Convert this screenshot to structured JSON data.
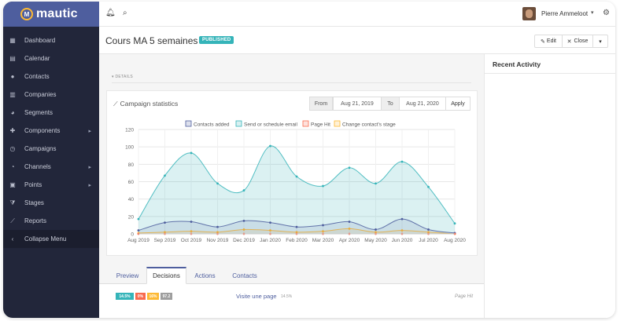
{
  "brand": {
    "name": "mautic",
    "logo_letter": "M"
  },
  "sidebar": {
    "items": [
      {
        "label": "Dashboard",
        "icon": "th-icon",
        "glyph": "▦"
      },
      {
        "label": "Calendar",
        "icon": "calendar-icon",
        "glyph": "▤"
      },
      {
        "label": "Contacts",
        "icon": "user-icon",
        "glyph": "●"
      },
      {
        "label": "Companies",
        "icon": "building-icon",
        "glyph": "▥"
      },
      {
        "label": "Segments",
        "icon": "pie-chart-icon",
        "glyph": "◕"
      },
      {
        "label": "Components",
        "icon": "puzzle-icon",
        "glyph": "✚",
        "has_children": true
      },
      {
        "label": "Campaigns",
        "icon": "clock-icon",
        "glyph": "◷"
      },
      {
        "label": "Channels",
        "icon": "rss-icon",
        "glyph": "◔",
        "has_children": true
      },
      {
        "label": "Points",
        "icon": "calculator-icon",
        "glyph": "▣",
        "has_children": true
      },
      {
        "label": "Stages",
        "icon": "filter-icon",
        "glyph": "⧩"
      },
      {
        "label": "Reports",
        "icon": "line-chart-icon",
        "glyph": "⟋"
      },
      {
        "label": "Collapse Menu",
        "icon": "chevron-left-icon",
        "glyph": "‹"
      }
    ]
  },
  "topbar": {
    "user_name": "Pierre Ammeloot"
  },
  "page": {
    "title": "Cours MA 5 semaines",
    "status": "PUBLISHED",
    "edit_label": "Edit",
    "close_label": "Close",
    "details_label": "▾ DETAILS"
  },
  "stats": {
    "title": "Campaign statistics",
    "from_label": "From",
    "from_value": "Aug 21, 2019",
    "to_label": "To",
    "to_value": "Aug 21, 2020",
    "apply_label": "Apply"
  },
  "chart_data": {
    "type": "area",
    "categories": [
      "Aug 2019",
      "Sep 2019",
      "Oct 2019",
      "Nov 2019",
      "Dec 2019",
      "Jan 2020",
      "Feb 2020",
      "Mar 2020",
      "Apr 2020",
      "May 2020",
      "Jun 2020",
      "Jul 2020",
      "Aug 2020"
    ],
    "ylim": [
      0,
      120
    ],
    "yticks": [
      0,
      20,
      40,
      60,
      80,
      100,
      120
    ],
    "grid": true,
    "legend_position": "top",
    "series": [
      {
        "name": "Contacts added",
        "color": "#4e5e9e",
        "values": [
          4,
          13,
          14,
          8,
          15,
          13,
          8,
          10,
          14,
          5,
          17,
          5,
          1
        ]
      },
      {
        "name": "Send or schedule email",
        "color": "#35b4b9",
        "values": [
          17,
          67,
          93,
          58,
          50,
          101,
          66,
          55,
          76,
          58,
          83,
          54,
          12
        ]
      },
      {
        "name": "Page Hit",
        "color": "#f86b4f",
        "values": [
          0,
          0,
          0,
          0,
          0,
          0,
          0,
          0,
          0,
          0,
          0,
          0,
          0
        ]
      },
      {
        "name": "Change contact's stage",
        "color": "#fdb933",
        "values": [
          1,
          2,
          3,
          2,
          5,
          4,
          2,
          3,
          6,
          2,
          4,
          2,
          0
        ]
      }
    ]
  },
  "tabs": [
    {
      "label": "Preview",
      "active": false
    },
    {
      "label": "Decisions",
      "active": true
    },
    {
      "label": "Actions",
      "active": false
    },
    {
      "label": "Contacts",
      "active": false
    }
  ],
  "decision": {
    "badges": [
      {
        "text": "14.5%",
        "color": "#35b4b9"
      },
      {
        "text": "0%",
        "color": "#f86b4f"
      },
      {
        "text": "16%",
        "color": "#fdb933"
      },
      {
        "text": "97.2",
        "color": "#9e9e9e"
      }
    ],
    "name": "Visite une page",
    "pct": "14.5%",
    "type": "Page Hit"
  },
  "right": {
    "title": "Recent Activity"
  }
}
